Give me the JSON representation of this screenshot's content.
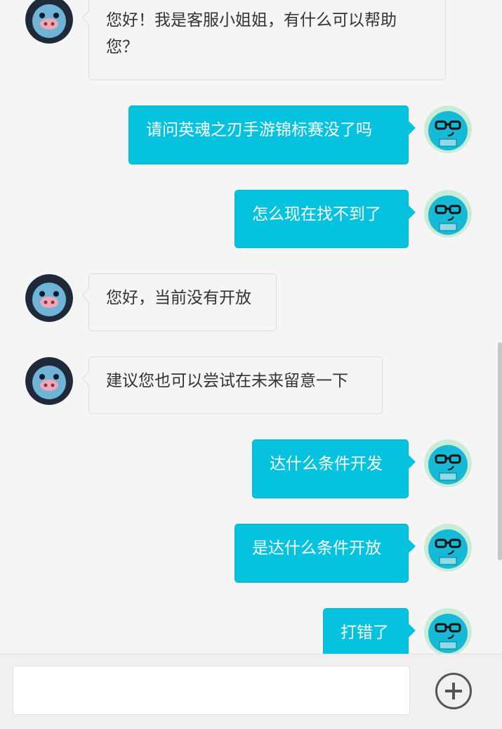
{
  "messages": [
    {
      "side": "left",
      "text": "您好！我是客服小姐姐，有什么可以帮助您？"
    },
    {
      "side": "right",
      "text": "请问英魂之刃手游锦标赛没了吗"
    },
    {
      "side": "right",
      "text": "怎么现在找不到了"
    },
    {
      "side": "left",
      "text": "您好，当前没有开放"
    },
    {
      "side": "left",
      "text": "建议您也可以尝试在未来留意一下"
    },
    {
      "side": "right",
      "text": "达什么条件开发"
    },
    {
      "side": "right",
      "text": "是达什么条件开放"
    },
    {
      "side": "right",
      "text": "打错了"
    }
  ],
  "input": {
    "placeholder": "",
    "value": ""
  },
  "icons": {
    "agent_avatar": "pig-avatar-icon",
    "user_avatar": "robot-glasses-avatar-icon",
    "send_more": "plus-circle-icon"
  },
  "colors": {
    "user_bubble": "#05c3de",
    "agent_bubble": "#f5f5f5",
    "background": "#f5f5f5"
  }
}
